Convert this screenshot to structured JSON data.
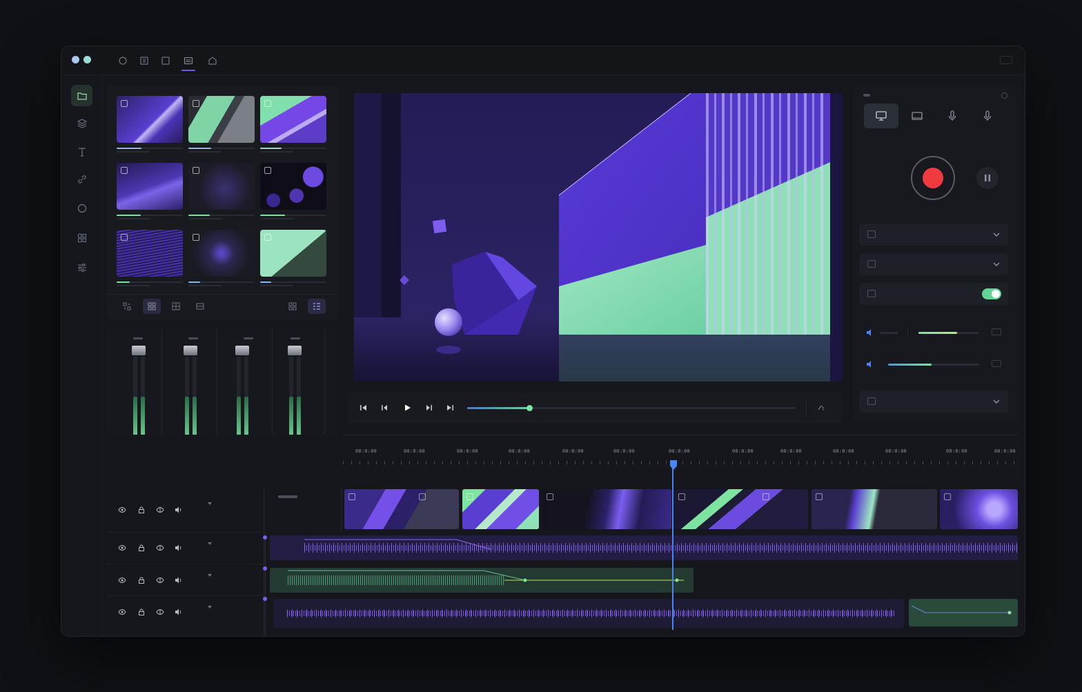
{
  "app": {
    "titlebar_icons": [
      "circle-icon",
      "film-icon",
      "square-icon",
      "sliders-icon",
      "home-icon"
    ],
    "active_titlebar_icon": "sliders-icon"
  },
  "rail": {
    "items": [
      "folder-icon",
      "layers-icon",
      "text-icon",
      "link-icon",
      "circle-icon",
      "grid-icon",
      "adjust-icon"
    ],
    "active": "folder-icon"
  },
  "media_bin": {
    "thumbs": [
      {
        "name": "thumb-1",
        "progress": 0.38
      },
      {
        "name": "thumb-2",
        "progress": 0.34
      },
      {
        "name": "thumb-3",
        "progress": 0.32
      },
      {
        "name": "thumb-4",
        "progress": 0.36
      },
      {
        "name": "thumb-5",
        "progress": 0.32
      },
      {
        "name": "thumb-6",
        "progress": 0.38
      },
      {
        "name": "thumb-7",
        "progress": 0.2
      },
      {
        "name": "thumb-8",
        "progress": 0.18
      },
      {
        "name": "thumb-9",
        "progress": 0.17
      }
    ],
    "view_modes": [
      "view-grid-small",
      "view-grid-medium",
      "view-grid-large",
      "view-filmstrip",
      "view-list",
      "view-detail"
    ],
    "active_view": "view-detail"
  },
  "mixer": {
    "channels": [
      {
        "name": "channel-1",
        "level_left": 0.56,
        "level_right": 0.56
      },
      {
        "name": "channel-2",
        "level_left": 0.56,
        "level_right": 0.56
      },
      {
        "name": "channel-3",
        "level_left": 0.56,
        "level_right": 0.56
      },
      {
        "name": "channel-4",
        "level_left": 0.56,
        "level_right": 0.56
      }
    ]
  },
  "transport": {
    "buttons": [
      "skip-start-icon",
      "step-back-icon",
      "play-icon",
      "step-forward-icon",
      "skip-end-icon"
    ],
    "progress": 0.19
  },
  "recorder": {
    "sources": [
      "monitor-icon",
      "screen-icon",
      "microphone-icon",
      "microphone-alt-icon"
    ],
    "active_source": "monitor-icon",
    "toggle_on": true,
    "volume_1": 0.58,
    "volume_2": 0.52
  },
  "timeline": {
    "ruler_labels": [
      "00:0:00",
      "00:0:00",
      "00:0:00",
      "00:0:00",
      "00:0:00",
      "00:0:00",
      "00:0:00",
      "00:0:00",
      "00:0:00",
      "00:0:00",
      "00:0:00",
      "00:0:00",
      "00:0:00"
    ],
    "tracks": [
      "video-track",
      "audio-track-1",
      "audio-track-2",
      "audio-track-3"
    ]
  },
  "colors": {
    "accent_purple": "#6d4fe0",
    "accent_green": "#7de3a0",
    "record_red": "#ef3b3f",
    "playhead_blue": "#4d84f3"
  }
}
